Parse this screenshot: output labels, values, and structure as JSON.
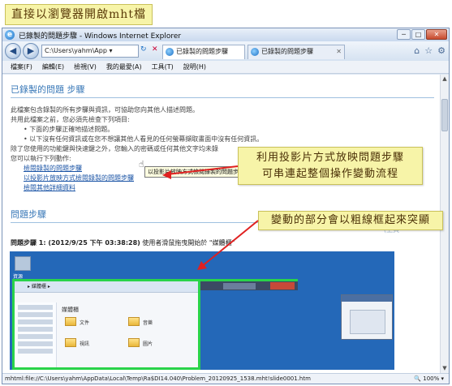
{
  "callouts": {
    "title": "直接以瀏覽器開啟mht檔",
    "slideshow_line1": "利用投影片方式放映問題步驟",
    "slideshow_line2": "可串連起整個操作變動流程",
    "highlight": "變動的部分會以粗線框起來突顯"
  },
  "window": {
    "title": "已錄製的問題步驟 - Windows Internet Explorer",
    "minimize": "─",
    "maximize": "□",
    "close": "✕"
  },
  "navbar": {
    "back": "◀",
    "forward": "▶",
    "address": "C:\\Users\\yahm\\App ▾",
    "refresh_icon": "↻",
    "stop_icon": "✕",
    "tab1": "已錄製的問題步驟",
    "tab2": "已錄製的問題步驟",
    "tab_close": "✕",
    "home_icon": "⌂",
    "favorites_icon": "☆",
    "tools_icon": "⚙"
  },
  "menu": [
    "檔案(F)",
    "編輯(E)",
    "檢視(V)",
    "我的最愛(A)",
    "工具(T)",
    "說明(H)"
  ],
  "content": {
    "heading": "已錄製的問題 步驟",
    "intro1": "此檔案包含錄製的所有步驟與資訊，可協助您向其他人描述問題。",
    "intro2": "共用此檔案之前，您必須先檢查下列項目:",
    "bullet1": "下面的步驟正確地描述問題。",
    "bullet2": "以下沒有任何資訊或在您不想讓其他人看見的任何螢幕擷取畫面中沒有任何資訊。",
    "intro3": "除了您使用的功能鍵與快速鍵之外，您輸入的密碼或任何其他文字均未錄",
    "intro4": "您可以執行下列動作:",
    "link1": "檢閱錄製的問題步驟",
    "link2": "以投影片放映方式檢閱錄製的問題步驟",
    "link3": "檢閱其他詳細資料",
    "tooltip": "以投影片放映方式檢閱錄製的問題步驟",
    "steps_heading": "問題步驟",
    "step1_label": "問題步驟 1: (2012/9/25 下午 03:38:28)",
    "step1_text": "使用者滑鼠拖曳開始於 \"媒體櫃\"",
    "page_hint": "(上頁"
  },
  "screenshot": {
    "desktop_label": "資源",
    "explorer_bar": "▸ 媒體櫃 ▸",
    "explorer_heading": "媒體櫃",
    "folder1": "文件",
    "folder2": "音樂",
    "folder3": "視訊",
    "folder4": "圖片"
  },
  "statusbar": {
    "path": "mhtml:file://C:\\Users\\yahm\\AppData\\Local\\Temp\\Ra$DI14.040\\Problem_20120925_1538.mht!slide0001.htm",
    "zoom": "🔍 100% ▾"
  },
  "colors": {
    "callout_bg": "#f7f4a8",
    "heading_blue": "#3a79b8",
    "link_blue": "#1c55a6",
    "highlight_green": "#29d34a",
    "arrow_red": "#e02020"
  }
}
